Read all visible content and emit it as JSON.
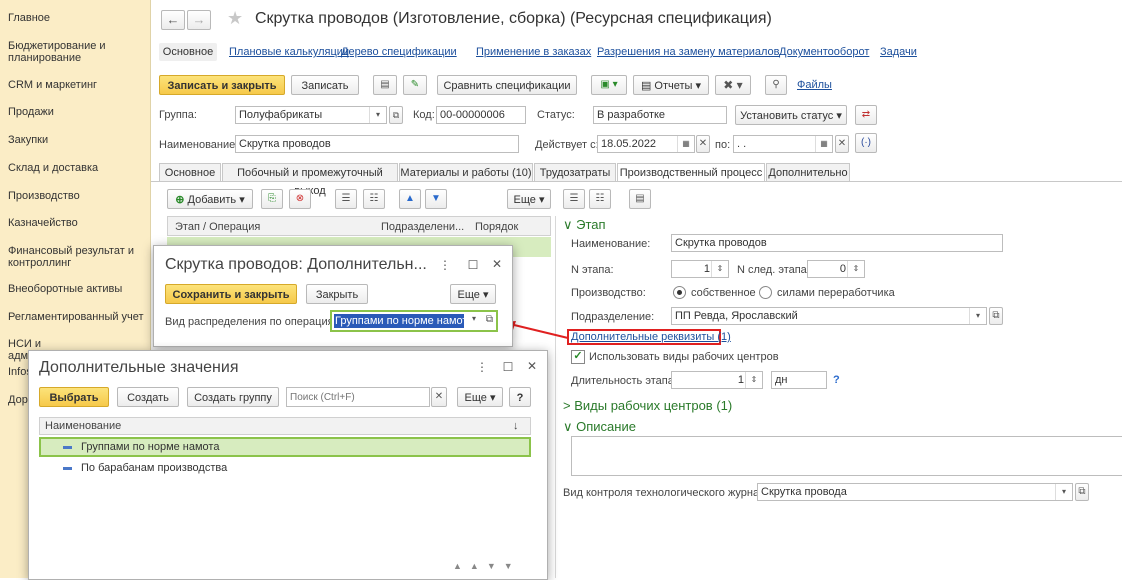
{
  "sidebar": {
    "items": [
      "Главное",
      "Бюджетирование и планирование",
      "CRM и маркетинг",
      "Продажи",
      "Закупки",
      "Склад и доставка",
      "Производство",
      "Казначейство",
      "Финансовый результат и контроллинг",
      "Внеоборотные активы",
      "Регламентированный учет",
      "НСИ и администрирование",
      "Infos",
      "Дора"
    ]
  },
  "header": {
    "title": "Скрутка проводов (Изготовление, сборка) (Ресурсная спецификация)",
    "back": "←",
    "forward": "→",
    "star": "★"
  },
  "nav": {
    "links": [
      "Основное",
      "Плановые калькуляции",
      "Дерево спецификации",
      "Применение в заказах",
      "Разрешения на замену материалов",
      "Документооборот",
      "Задачи"
    ]
  },
  "toolbar": {
    "save_close": "Записать и закрыть",
    "save": "Записать",
    "compare": "Сравнить спецификации",
    "reports": "Отчеты",
    "files": "Файлы"
  },
  "form": {
    "group_label": "Группа:",
    "group_value": "Полуфабрикаты",
    "code_label": "Код:",
    "code_value": "00-00000006",
    "status_label": "Статус:",
    "status_value": "В разработке",
    "set_status": "Установить статус",
    "name_label": "Наименование:",
    "name_value": "Скрутка проводов",
    "valid_label": "Действует с:",
    "valid_from": "18.05.2022",
    "valid_to_label": "по:",
    "valid_to": ". ."
  },
  "tabs": [
    "Основное",
    "Побочный и промежуточный выход",
    "Материалы и работы (10)",
    "Трудозатраты",
    "Производственный процесс",
    "Дополнительно"
  ],
  "table": {
    "add": "Добавить",
    "more": "Еще",
    "col_stage": "Этап / Операция",
    "col_dept": "Подразделени...",
    "col_order": "Порядок"
  },
  "stage": {
    "section": "Этап",
    "name_label": "Наименование:",
    "name_value": "Скрутка проводов",
    "num_label": "N этапа:",
    "num_value": "1",
    "next_label": "N след. этапа:",
    "next_value": "0",
    "prod_label": "Производство:",
    "prod_own": "собственное",
    "prod_ext": "силами переработчика",
    "dept_label": "Подразделение:",
    "dept_value": "ПП Ревда, Ярославский",
    "extra_link": "Дополнительные реквизиты (1)",
    "use_wc": "Использовать виды рабочих центров",
    "dur_label": "Длительность этапа:",
    "dur_value": "1",
    "dur_unit": "дн",
    "help": "?",
    "wc_section": "Виды рабочих центров (1)",
    "desc_section": "Описание",
    "journal_label": "Вид контроля технологического журнала:",
    "journal_value": "Скрутка провода"
  },
  "dialog1": {
    "title": "Скрутка проводов: Дополнительн...",
    "save_close": "Сохранить и закрыть",
    "close": "Закрыть",
    "more": "Еще",
    "field_label": "Вид распределения по операциям:",
    "field_value": "Группами по норме намота"
  },
  "dialog2": {
    "title": "Дополнительные значения",
    "select": "Выбрать",
    "create": "Создать",
    "create_group": "Создать группу",
    "search_placeholder": "Поиск (Ctrl+F)",
    "more": "Еще",
    "help": "?",
    "col_name": "Наименование",
    "sort_icon": "↓",
    "rows": [
      "Группами по норме намота",
      "По барабанам производства"
    ]
  },
  "colors": {
    "accent": "#f6c94a",
    "sidebar": "#fbedc6",
    "arrow": "#e02020"
  }
}
